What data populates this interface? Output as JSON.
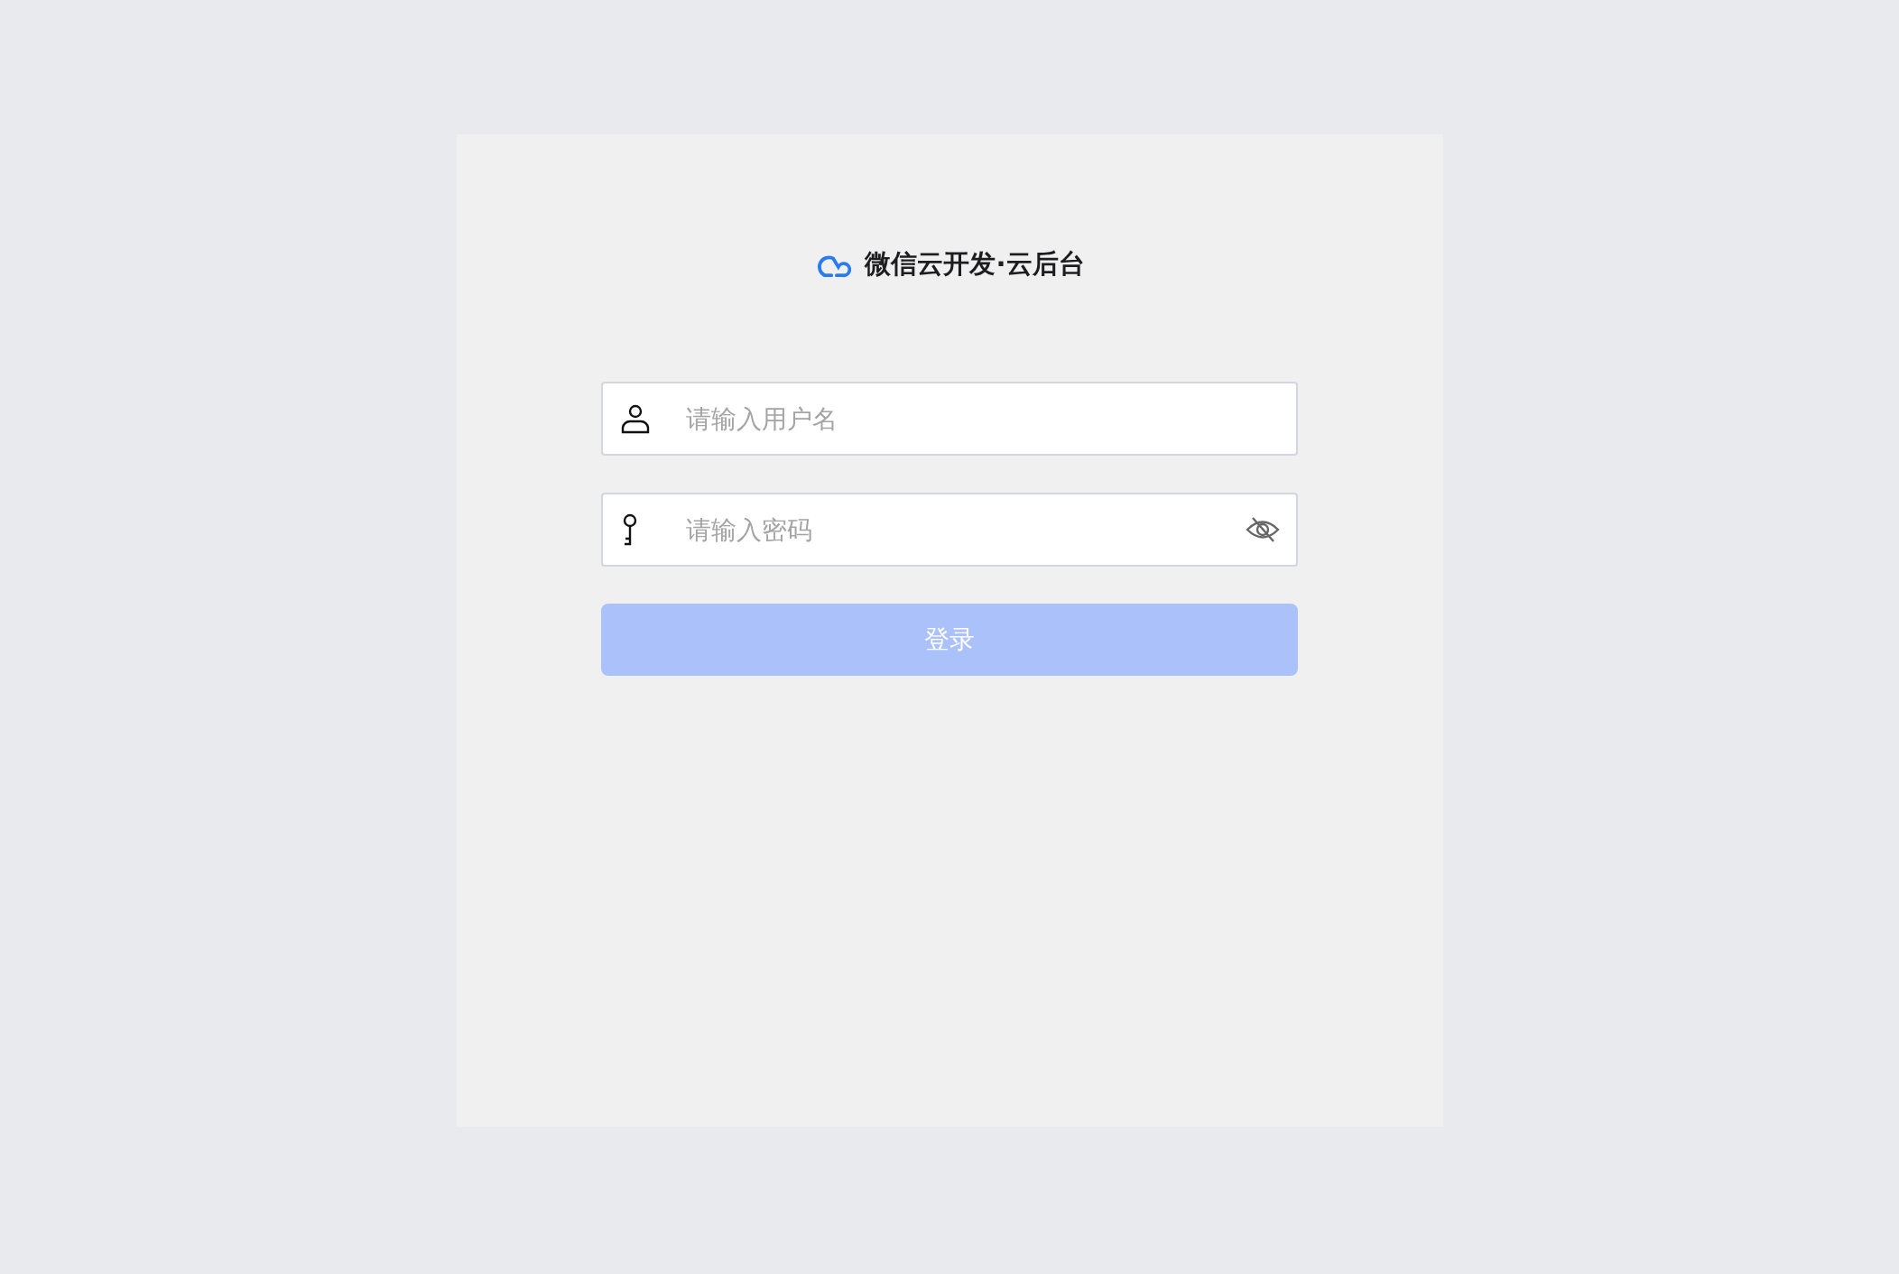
{
  "title": "微信云开发·云后台",
  "fields": [
    {
      "kind": "username",
      "placeholder": "请输入用户名"
    },
    {
      "kind": "password",
      "placeholder": "请输入密码"
    }
  ],
  "login_button": {
    "label": "登录",
    "disabled": true
  }
}
